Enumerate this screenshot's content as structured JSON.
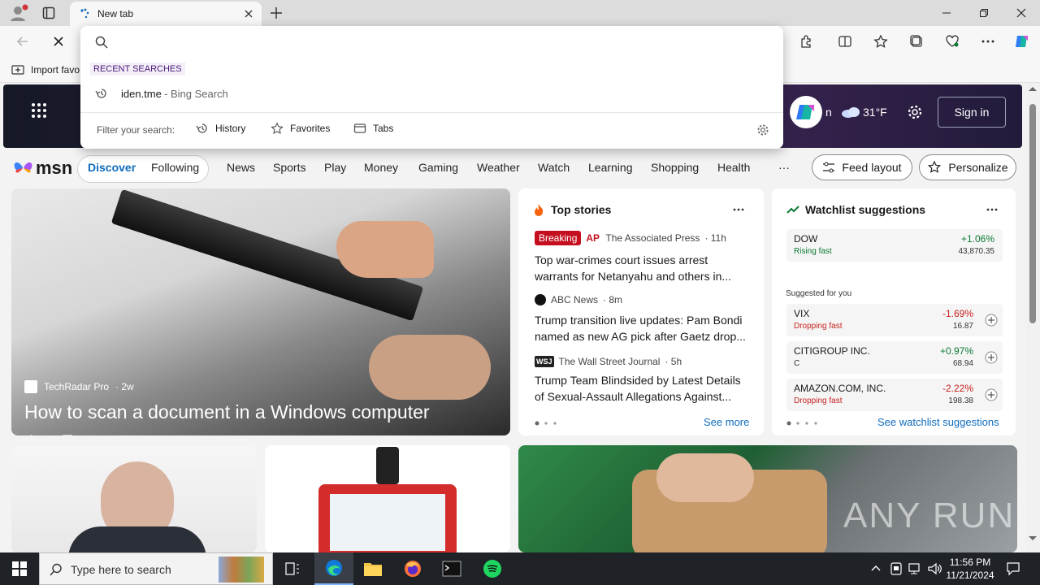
{
  "browser": {
    "tab_title": "New tab",
    "favorites_import": "Import favo"
  },
  "dropdown": {
    "recent_header": "RECENT SEARCHES",
    "recent_item_query": "iden.tme",
    "recent_item_suffix": " - Bing Search",
    "filter_label": "Filter your search:",
    "filters": [
      "History",
      "Favorites",
      "Tabs"
    ]
  },
  "msn": {
    "brand": "msn",
    "weather_temp": "31°F",
    "signin_label": "Sign in",
    "nav_primary": [
      "Discover",
      "Following"
    ],
    "nav_items": [
      "News",
      "Sports",
      "Play",
      "Money",
      "Gaming",
      "Weather",
      "Watch",
      "Learning",
      "Shopping",
      "Health"
    ],
    "more_label": "···",
    "feed_layout_label": "Feed layout",
    "personalize_label": "Personalize"
  },
  "main_story": {
    "source": "TechRadar Pro",
    "age": "· 2w",
    "title": "How to scan a document in a Windows computer",
    "likes": "11"
  },
  "top_stories": {
    "header": "Top stories",
    "breaking_badge": "Breaking",
    "items": [
      {
        "logo": "AP",
        "source": "The Associated Press",
        "age": "· 11h",
        "headline": "Top war-crimes court issues arrest",
        "headline2": "warrants for Netanyahu and others in..."
      },
      {
        "logo": "",
        "source": "ABC News",
        "age": "· 8m",
        "headline": "Trump transition live updates: Pam Bondi",
        "headline2": "named as new AG pick after Gaetz drop..."
      },
      {
        "logo": "WSJ",
        "source": "The Wall Street Journal",
        "age": "· 5h",
        "headline": "Trump Team Blindsided by Latest Details",
        "headline2": "of Sexual-Assault Allegations Against..."
      }
    ],
    "see_more": "See more"
  },
  "watchlist": {
    "header": "Watchlist suggestions",
    "dow": {
      "name": "DOW",
      "status": "Rising fast",
      "change": "+1.06%",
      "value": "43,870.35"
    },
    "suggested_label": "Suggested for you",
    "items": [
      {
        "name": "VIX",
        "status": "Dropping fast",
        "change": "-1.69%",
        "value": "16.87"
      },
      {
        "name": "CITIGROUP INC.",
        "status": "C",
        "change": "+0.97%",
        "value": "68.94"
      },
      {
        "name": "AMAZON.COM, INC.",
        "status": "Dropping fast",
        "change": "-2.22%",
        "value": "198.38"
      }
    ],
    "see_link": "See watchlist suggestions"
  },
  "copilot_partial_text": "n",
  "watermark": "ANY RUN",
  "taskbar": {
    "search_placeholder": "Type here to search",
    "time": "11:56 PM",
    "date": "11/21/2024"
  },
  "colors": {
    "accent": "#0f6cbd",
    "breaking": "#c50f1f",
    "positive": "#0a7a33",
    "negative": "#c5221f"
  }
}
